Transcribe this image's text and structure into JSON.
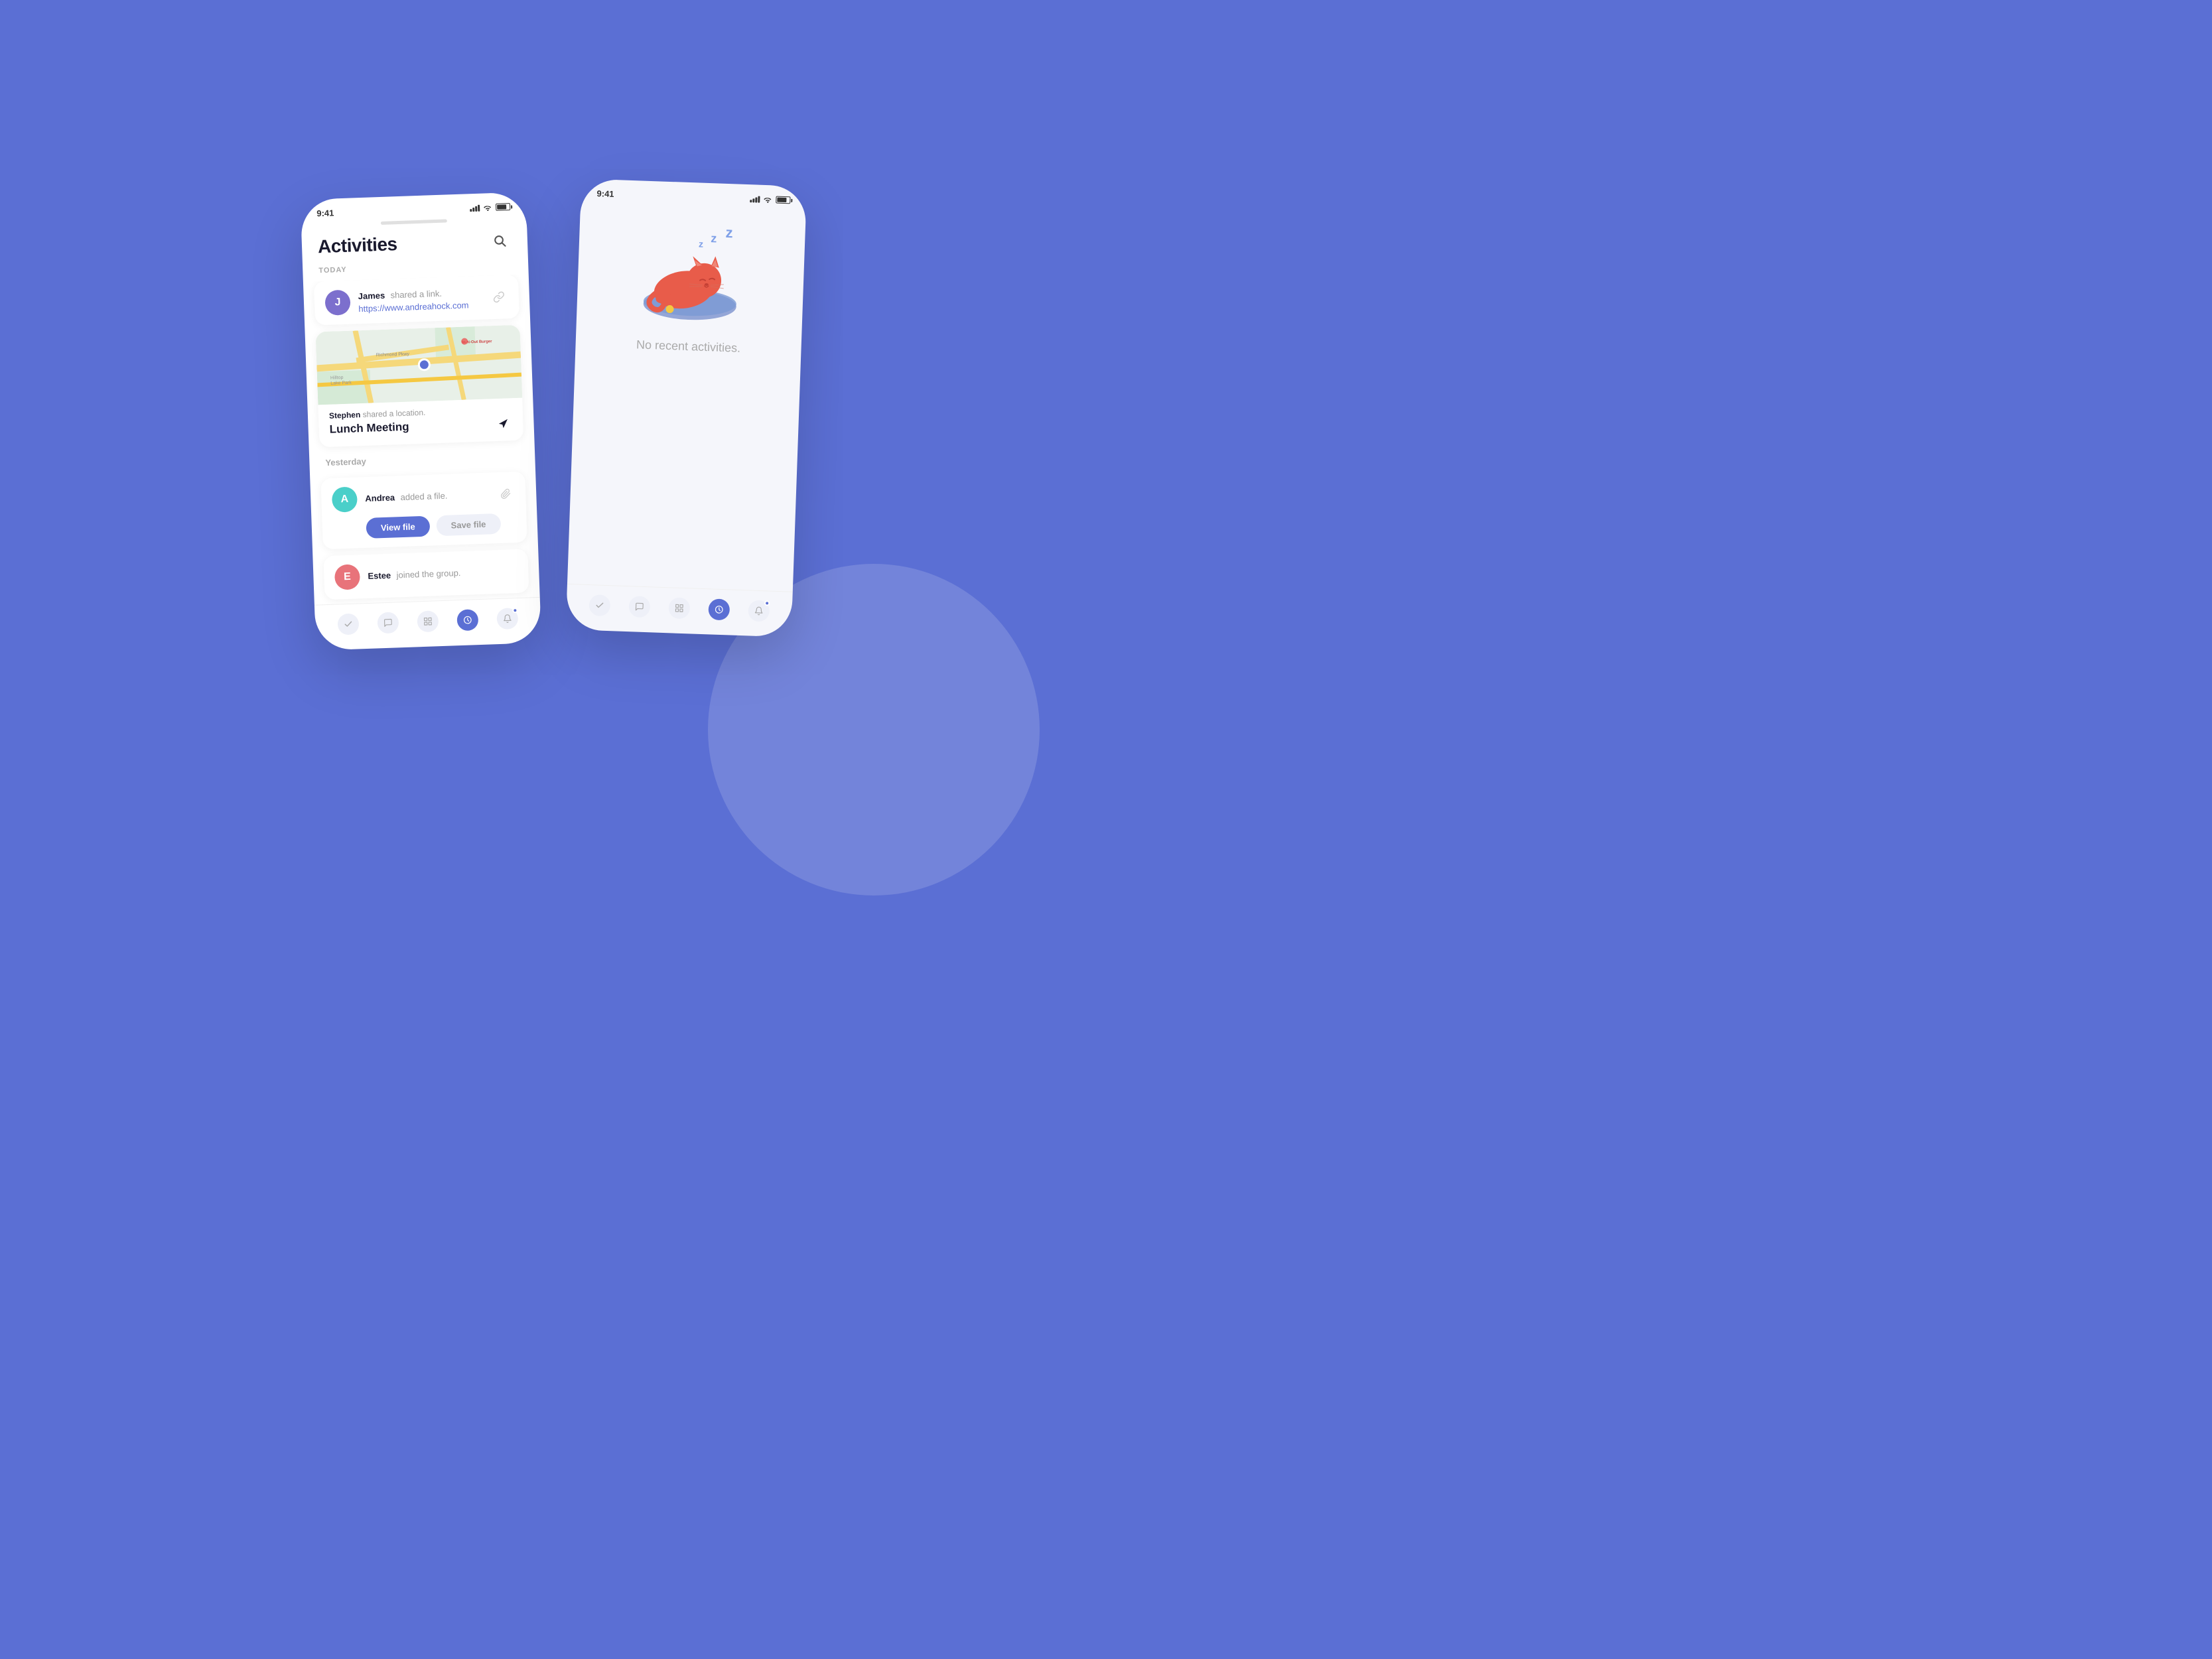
{
  "background": {
    "color": "#5b6fd4"
  },
  "phone1": {
    "status_bar": {
      "time": "9:41",
      "signal": true,
      "wifi": true,
      "battery": true
    },
    "header": {
      "title": "Activities",
      "search_aria": "search"
    },
    "sections": [
      {
        "label": "Today",
        "items": [
          {
            "type": "link",
            "avatar_initial": "J",
            "avatar_color": "#7c6fcd",
            "name": "James",
            "action": "shared a link.",
            "link": "https://www.andreahock.com"
          },
          {
            "type": "location",
            "map": true,
            "name": "Stephen",
            "action": "shared a location.",
            "location_title": "Lunch Meeting"
          }
        ]
      },
      {
        "label": "Yesterday",
        "items": [
          {
            "type": "file",
            "avatar_initial": "A",
            "avatar_color": "#4acfc9",
            "name": "Andrea",
            "action": "added a file.",
            "btn_view": "View file",
            "btn_save": "Save file"
          },
          {
            "type": "join",
            "avatar_initial": "E",
            "avatar_color": "#e8737a",
            "name": "Estee",
            "action": "joined the group."
          }
        ]
      }
    ],
    "bottom_nav": [
      {
        "icon": "check",
        "active": false
      },
      {
        "icon": "chat",
        "active": false
      },
      {
        "icon": "grid",
        "active": false
      },
      {
        "icon": "clock",
        "active": true
      },
      {
        "icon": "bell",
        "active": false,
        "dot": true
      }
    ]
  },
  "phone2": {
    "empty_state": {
      "text": "No recent activities."
    },
    "bottom_nav": [
      {
        "icon": "check",
        "active": false
      },
      {
        "icon": "chat",
        "active": false
      },
      {
        "icon": "grid",
        "active": false
      },
      {
        "icon": "clock",
        "active": true
      },
      {
        "icon": "bell",
        "active": false,
        "dot": true
      }
    ]
  }
}
